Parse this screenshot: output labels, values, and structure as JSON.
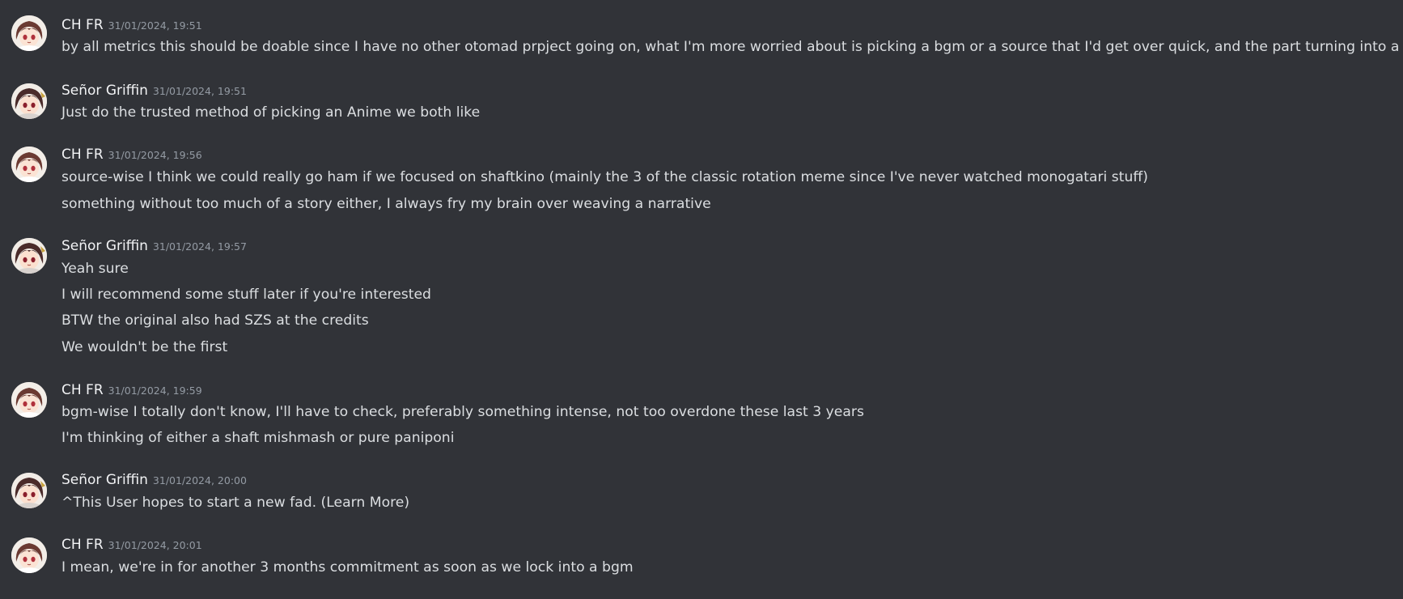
{
  "messages": [
    {
      "author": "CH FR",
      "timestamp": "31/01/2024, 19:51",
      "avatar_icon": "anime-avatar-icon",
      "lines": [
        "by all metrics this should be doable since I have no other otomad prpject going on, what I'm more worried about is picking a bgm or a source that I'd get over quick, and the part turning into a chore"
      ]
    },
    {
      "author": "Señor Griffin",
      "timestamp": "31/01/2024, 19:51",
      "avatar_icon": "anime-avatar-icon",
      "lines": [
        "Just do the trusted method of picking an Anime we both like"
      ]
    },
    {
      "author": "CH FR",
      "timestamp": "31/01/2024, 19:56",
      "avatar_icon": "anime-avatar-icon",
      "lines": [
        "source-wise I think we could really go ham if we focused on shaftkino (mainly the 3 of the classic rotation meme since I've never watched monogatari stuff)",
        "something without too much of a story either, I always fry my brain over weaving a narrative"
      ]
    },
    {
      "author": "Señor Griffin",
      "timestamp": "31/01/2024, 19:57",
      "avatar_icon": "anime-avatar-icon",
      "lines": [
        "Yeah sure",
        "I will recommend some stuff later if you're interested",
        "BTW the original also had SZS at the credits",
        "We wouldn't be the first"
      ]
    },
    {
      "author": "CH FR",
      "timestamp": "31/01/2024, 19:59",
      "avatar_icon": "anime-avatar-icon",
      "lines": [
        "bgm-wise I totally don't know, I'll have to check, preferably something intense, not too overdone these last 3 years",
        "I'm thinking of either a shaft mishmash or pure paniponi"
      ]
    },
    {
      "author": "Señor Griffin",
      "timestamp": "31/01/2024, 20:00",
      "avatar_icon": "anime-avatar-icon",
      "lines": [
        "^This User hopes to start a new fad. (Learn More)"
      ]
    },
    {
      "author": "CH FR",
      "timestamp": "31/01/2024, 20:01",
      "avatar_icon": "anime-avatar-icon",
      "lines": [
        "I mean, we're in for another 3 months commitment as soon as we lock into a bgm"
      ]
    }
  ],
  "colors": {
    "background": "#313338",
    "author": "#f2f3f5",
    "timestamp": "#949ba4",
    "text": "#dbdee1"
  }
}
